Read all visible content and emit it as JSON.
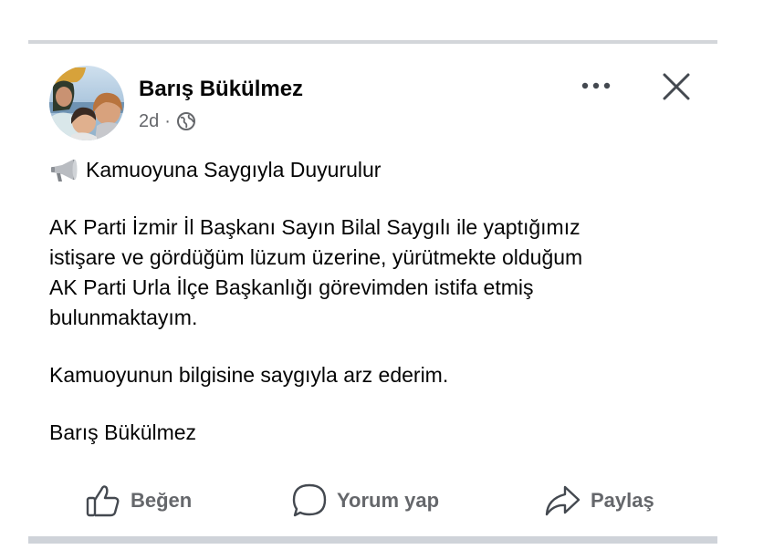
{
  "post": {
    "author_name": "Barış Bükülmez",
    "time_ago": "2d",
    "meta_separator": "·",
    "privacy_icon": "globe-icon",
    "headline_icon": "megaphone-icon",
    "headline": "Kamuoyuna Saygıyla Duyurulur",
    "paragraph_1": "AK Parti İzmir İl Başkanı Sayın Bilal Saygılı ile yaptığımız\nistişare ve gördüğüm lüzum üzerine, yürütmekte olduğum\nAK Parti Urla İlçe Başkanlığı görevimden istifa etmiş\nbulunmaktayım.",
    "paragraph_2": "Kamuoyunun bilgisine saygıyla arz ederim.",
    "signature": "Barış Bükülmez"
  },
  "header_actions": {
    "more_icon": "more-icon",
    "close_icon": "close-icon"
  },
  "actions": {
    "like_label": "Beğen",
    "comment_label": "Yorum yap",
    "share_label": "Paylaş"
  },
  "colors": {
    "text": "#050505",
    "secondary_text": "#65676b",
    "divider": "#d3d6da"
  }
}
